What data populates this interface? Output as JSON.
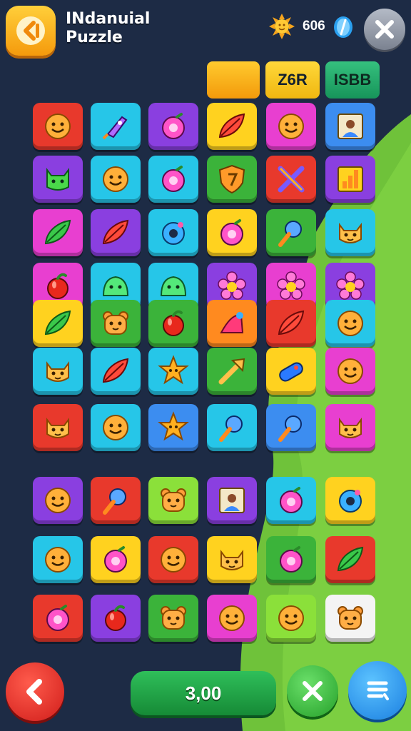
{
  "header": {
    "title_line1": "INdanuial",
    "title_line2": "Puzzle",
    "coins": "606",
    "back_icon": "chevron-left-icon",
    "close_icon": "close-icon"
  },
  "tabs": [
    {
      "label": ""
    },
    {
      "label": "Z6R"
    },
    {
      "label": "ISBB"
    }
  ],
  "colors": {
    "red": "#e8392c",
    "cyan": "#26c6e8",
    "purple": "#8a3fe0",
    "yellow": "#ffd21f",
    "magenta": "#e83fd0",
    "blue": "#3c8df0",
    "green": "#3bb33a",
    "lime": "#8be03a",
    "orange": "#ff8a1f",
    "white": "#f4f4f4"
  },
  "grid": {
    "rows": [
      [
        {
          "c": "red",
          "i": "smiley"
        },
        {
          "c": "cyan",
          "i": "rocket"
        },
        {
          "c": "purple",
          "i": "orb"
        },
        {
          "c": "yellow",
          "i": "leaf-red"
        },
        {
          "c": "magenta",
          "i": "smiley"
        },
        {
          "c": "blue",
          "i": "picture"
        }
      ],
      [
        {
          "c": "purple",
          "i": "monster"
        },
        {
          "c": "cyan",
          "i": "smiley"
        },
        {
          "c": "cyan",
          "i": "orb"
        },
        {
          "c": "green",
          "i": "shield"
        },
        {
          "c": "red",
          "i": "cross"
        },
        {
          "c": "purple",
          "i": "bars"
        }
      ],
      [
        {
          "c": "magenta",
          "i": "leaf"
        },
        {
          "c": "purple",
          "i": "leaf-red"
        },
        {
          "c": "cyan",
          "i": "donut"
        },
        {
          "c": "yellow",
          "i": "orb"
        },
        {
          "c": "green",
          "i": "pin"
        },
        {
          "c": "cyan",
          "i": "cat"
        }
      ],
      [
        {
          "c": "magenta",
          "i": "apple"
        },
        {
          "c": "cyan",
          "i": "slime"
        },
        {
          "c": "cyan",
          "i": "slime"
        },
        {
          "c": "purple",
          "i": "flower"
        },
        {
          "c": "magenta",
          "i": "flower"
        },
        {
          "c": "purple",
          "i": "flower"
        }
      ],
      [
        {
          "c": "yellow",
          "i": "leaf"
        },
        {
          "c": "green",
          "i": "bear"
        },
        {
          "c": "green",
          "i": "apple"
        },
        {
          "c": "orange",
          "i": "hat"
        },
        {
          "c": "red",
          "i": "leaf-red"
        },
        {
          "c": "cyan",
          "i": "smiley"
        }
      ],
      [
        {
          "c": "cyan",
          "i": "cat"
        },
        {
          "c": "cyan",
          "i": "leaf-red"
        },
        {
          "c": "cyan",
          "i": "star"
        },
        {
          "c": "green",
          "i": "arrow"
        },
        {
          "c": "yellow",
          "i": "pill"
        },
        {
          "c": "magenta",
          "i": "smiley"
        }
      ],
      [
        {
          "c": "red",
          "i": "cat"
        },
        {
          "c": "cyan",
          "i": "smiley"
        },
        {
          "c": "blue",
          "i": "star"
        },
        {
          "c": "cyan",
          "i": "pin"
        },
        {
          "c": "blue",
          "i": "pin"
        },
        {
          "c": "magenta",
          "i": "cat"
        }
      ],
      [
        {
          "c": "purple",
          "i": "smiley"
        },
        {
          "c": "red",
          "i": "pin"
        },
        {
          "c": "lime",
          "i": "bear"
        },
        {
          "c": "purple",
          "i": "picture"
        },
        {
          "c": "cyan",
          "i": "orb"
        },
        {
          "c": "yellow",
          "i": "donut"
        }
      ],
      [
        {
          "c": "cyan",
          "i": "smiley"
        },
        {
          "c": "yellow",
          "i": "orb"
        },
        {
          "c": "red",
          "i": "smiley"
        },
        {
          "c": "yellow",
          "i": "cat"
        },
        {
          "c": "green",
          "i": "orb"
        },
        {
          "c": "red",
          "i": "leaf"
        }
      ],
      [
        {
          "c": "red",
          "i": "orb"
        },
        {
          "c": "purple",
          "i": "apple"
        },
        {
          "c": "green",
          "i": "bear"
        },
        {
          "c": "magenta",
          "i": "smiley"
        },
        {
          "c": "lime",
          "i": "smiley"
        },
        {
          "c": "white",
          "i": "bear"
        }
      ]
    ]
  },
  "footer": {
    "score": "3,00",
    "back_icon": "chevron-left-icon",
    "check_icon": "close-icon",
    "menu_icon": "menu-icon"
  }
}
